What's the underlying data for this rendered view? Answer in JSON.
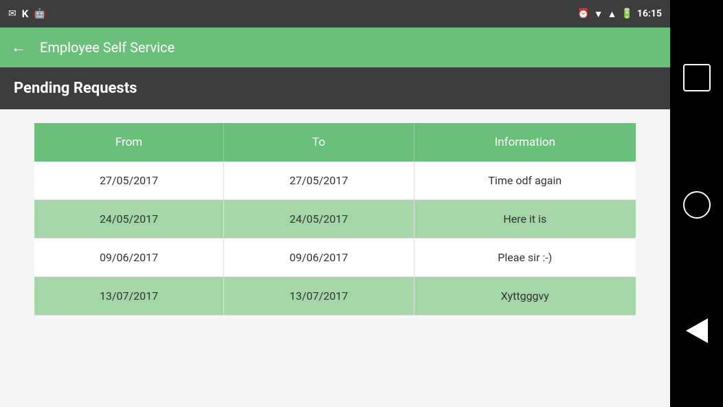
{
  "statusBar": {
    "time": "16:15",
    "icons": [
      "alarm",
      "wifi",
      "signal",
      "battery"
    ]
  },
  "appBar": {
    "title": "Employee Self Service",
    "backLabel": "←"
  },
  "section": {
    "title": "Pending Requests"
  },
  "table": {
    "headers": [
      "From",
      "To",
      "Information"
    ],
    "rows": [
      {
        "from": "27/05/2017",
        "to": "27/05/2017",
        "info": "Time odf again",
        "highlighted": false
      },
      {
        "from": "24/05/2017",
        "to": "24/05/2017",
        "info": "Here it is",
        "highlighted": true
      },
      {
        "from": "09/06/2017",
        "to": "09/06/2017",
        "info": "Pleae sir :-)",
        "highlighted": false
      },
      {
        "from": "13/07/2017",
        "to": "13/07/2017",
        "info": "Xyttgggvy",
        "highlighted": true
      }
    ]
  },
  "sidePanel": {
    "square_label": "□",
    "circle_label": "○",
    "triangle_label": "◁"
  }
}
